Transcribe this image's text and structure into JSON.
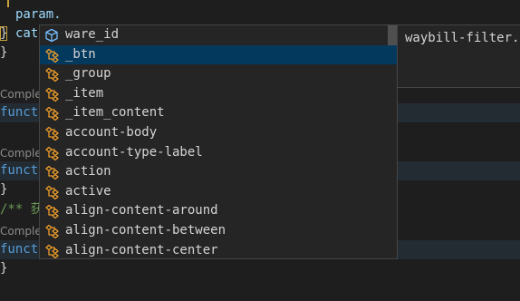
{
  "editor": {
    "line1": "param.",
    "line2_prefix": "cat",
    "brace_close": "}",
    "hint1": "Comple",
    "func_prefix": "funct",
    "hint2": "Comple",
    "comment_prefix": "/** 获",
    "hint3": "Comple"
  },
  "suggest": {
    "items": [
      {
        "label": "ware_id",
        "icon": "cube-icon"
      },
      {
        "label": "_btn",
        "icon": "class-icon"
      },
      {
        "label": "_group",
        "icon": "class-icon"
      },
      {
        "label": "_item",
        "icon": "class-icon"
      },
      {
        "label": "_item_content",
        "icon": "class-icon"
      },
      {
        "label": "account-body",
        "icon": "class-icon"
      },
      {
        "label": "account-type-label",
        "icon": "class-icon"
      },
      {
        "label": "action",
        "icon": "class-icon"
      },
      {
        "label": "active",
        "icon": "class-icon"
      },
      {
        "label": "align-content-around",
        "icon": "class-icon"
      },
      {
        "label": "align-content-between",
        "icon": "class-icon"
      },
      {
        "label": "align-content-center",
        "icon": "class-icon"
      }
    ],
    "selected_index": 1
  },
  "details": {
    "text": "waybill-filter."
  },
  "colors": {
    "selection": "#04395e",
    "class_icon": "#ee9d28",
    "cube_icon": "#75beff",
    "keyword": "#569cd6"
  }
}
